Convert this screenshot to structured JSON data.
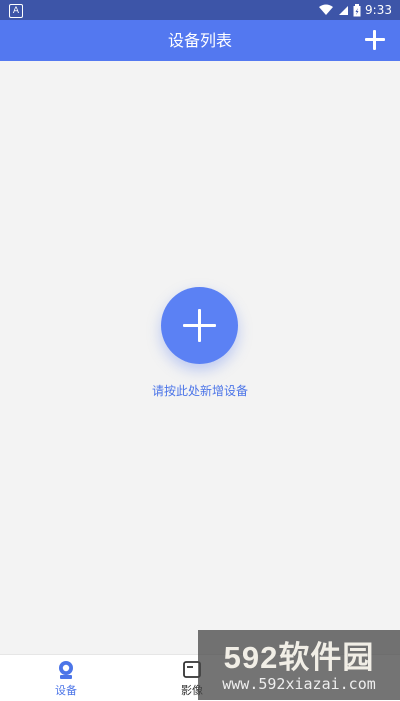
{
  "status_bar": {
    "left_icon": "A",
    "time": "9:33"
  },
  "header": {
    "title": "设备列表"
  },
  "main": {
    "prompt": "请按此处新增设备"
  },
  "bottom_nav": [
    {
      "label": "设备",
      "icon": "camera-icon"
    },
    {
      "label": "影像",
      "icon": "image-icon"
    }
  ],
  "watermark": {
    "brand": "592软件园",
    "url": "www.592xiazai.com"
  },
  "colors": {
    "primary": "#5378f0",
    "status_bar": "#3d55a8",
    "background": "#f3f3f3",
    "accent_text": "#4c75e8"
  }
}
